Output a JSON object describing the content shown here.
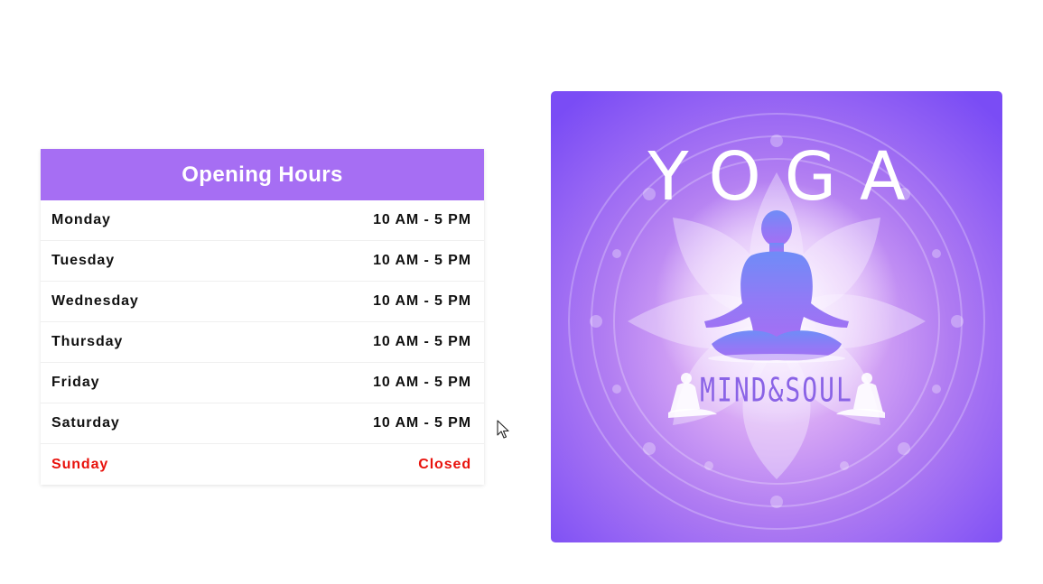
{
  "opening_hours": {
    "title": "Opening Hours",
    "header_color": "#a66ef3",
    "closed_color": "#e8120c",
    "rows": [
      {
        "day": "Monday",
        "hours": "10 AM - 5 PM",
        "closed": false
      },
      {
        "day": "Tuesday",
        "hours": "10 AM - 5 PM",
        "closed": false
      },
      {
        "day": "Wednesday",
        "hours": "10 AM - 5 PM",
        "closed": false
      },
      {
        "day": "Thursday",
        "hours": "10 AM - 5 PM",
        "closed": false
      },
      {
        "day": "Friday",
        "hours": "10 AM - 5 PM",
        "closed": false
      },
      {
        "day": "Saturday",
        "hours": "10 AM - 5 PM",
        "closed": false
      },
      {
        "day": "Sunday",
        "hours": "Closed",
        "closed": true
      }
    ]
  },
  "poster": {
    "title": "YOGA",
    "subtitle": "MIND&SOUL",
    "icon": "meditation-figure-icon",
    "gradient_colors": [
      "#8b5cf6",
      "#b07cf2",
      "#e9d8ff"
    ]
  },
  "cursor": {
    "icon": "mouse-pointer-icon"
  }
}
